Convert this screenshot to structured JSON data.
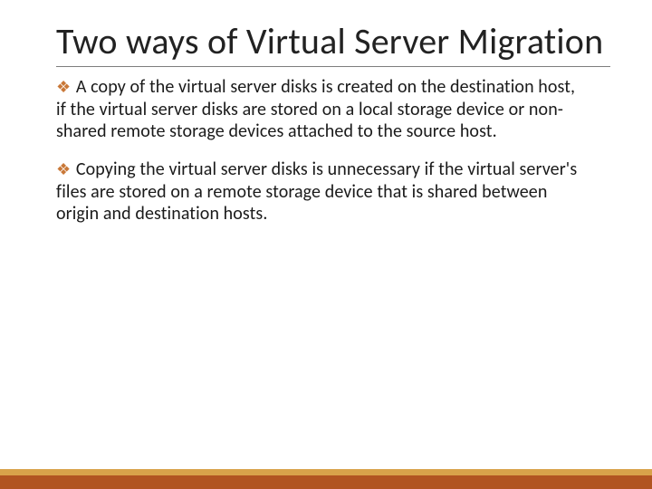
{
  "slide": {
    "title": "Two ways of Virtual Server Migration",
    "bullets": [
      "A copy of the virtual server disks is created on the destination host, if the virtual server disks are stored on a local storage device or non-shared remote storage devices attached to the source host.",
      "Copying the virtual server disks is unnecessary if the virtual server's files are stored on a remote storage device that is shared between origin and destination hosts."
    ],
    "bullet_glyph": "❖",
    "theme": {
      "accent_gold": "#d8a24a",
      "accent_rust": "#b15421",
      "bullet_color": "#c97838"
    }
  }
}
